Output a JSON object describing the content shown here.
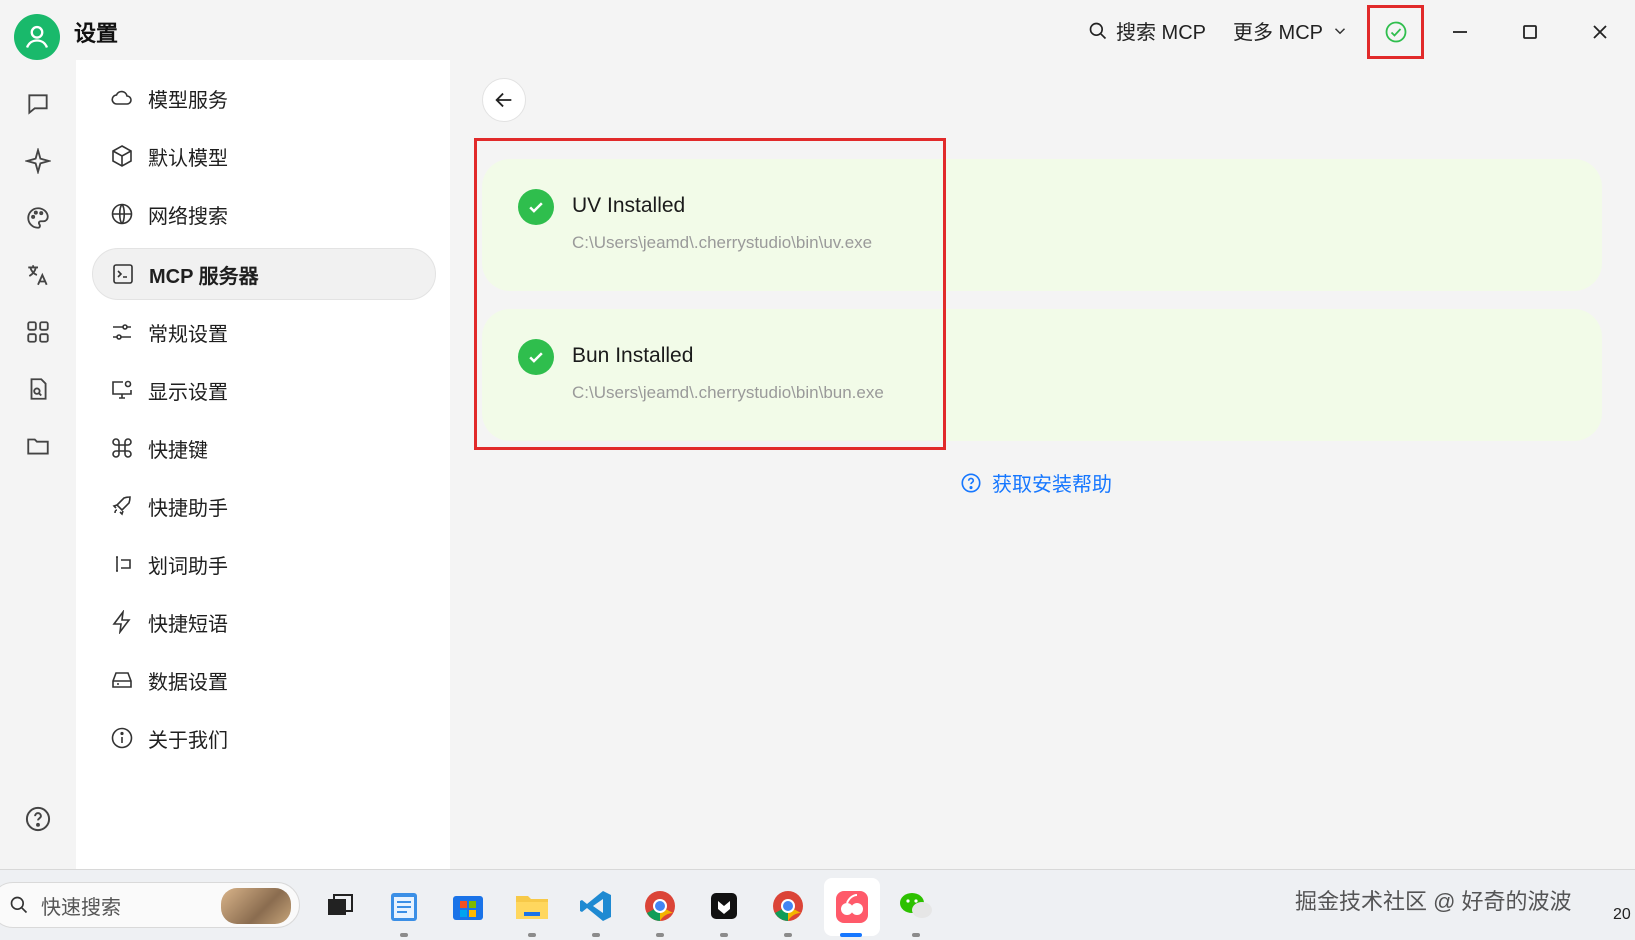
{
  "window": {
    "title": "设置",
    "search_mcp_label": "搜索 MCP",
    "more_mcp_label": "更多 MCP"
  },
  "menu": {
    "items": [
      {
        "label": "模型服务",
        "icon": "cloud-icon"
      },
      {
        "label": "默认模型",
        "icon": "cube-icon"
      },
      {
        "label": "网络搜索",
        "icon": "globe-icon"
      },
      {
        "label": "MCP 服务器",
        "icon": "terminal-icon",
        "active": true
      },
      {
        "label": "常规设置",
        "icon": "sliders-icon"
      },
      {
        "label": "显示设置",
        "icon": "monitor-settings-icon"
      },
      {
        "label": "快捷键",
        "icon": "command-icon"
      },
      {
        "label": "快捷助手",
        "icon": "rocket-icon"
      },
      {
        "label": "划词助手",
        "icon": "text-cursor-icon"
      },
      {
        "label": "快捷短语",
        "icon": "lightning-icon"
      },
      {
        "label": "数据设置",
        "icon": "hard-drive-icon"
      },
      {
        "label": "关于我们",
        "icon": "info-icon"
      }
    ]
  },
  "main": {
    "runtimes": [
      {
        "name": "UV Installed",
        "path": "C:\\Users\\jeamd\\.cherrystudio\\bin\\uv.exe"
      },
      {
        "name": "Bun Installed",
        "path": "C:\\Users\\jeamd\\.cherrystudio\\bin\\bun.exe"
      }
    ],
    "help_link": "获取安装帮助"
  },
  "taskbar": {
    "search_placeholder": "快速搜索",
    "watermark": "掘金技术社区 @ 好奇的波波",
    "clock": "20"
  },
  "colors": {
    "accent_green": "#19b96b",
    "success": "#2fbe4d",
    "card_bg": "#f2fbe8",
    "highlight_red": "#e12a2a",
    "link_blue": "#1677ff"
  }
}
